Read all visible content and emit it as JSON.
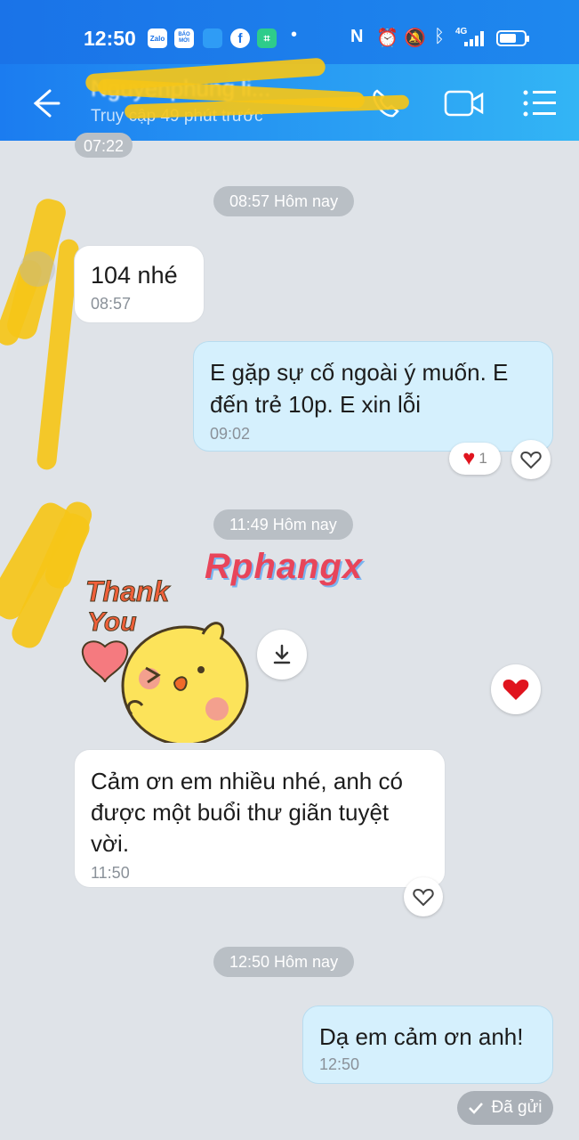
{
  "status_bar": {
    "time": "12:50",
    "apps": [
      "Zalo",
      "BÁO MỚI"
    ],
    "network": "4G",
    "battery_level": 0.7
  },
  "header": {
    "contact_name": "Nguyenphung li...",
    "last_seen": "Truy cập 49 phút trước",
    "icons": [
      "back-arrow-icon",
      "phone-icon",
      "video-call-icon",
      "menu-list-icon"
    ]
  },
  "chat": {
    "clipped_time": "07:22",
    "sections": [
      {
        "separator": "08:57 Hôm nay",
        "messages": [
          {
            "side": "in",
            "text": "104 nhé",
            "time": "08:57"
          },
          {
            "side": "out",
            "text": "E gặp sự cố ngoài ý muốn. E đến trẻ 10p. E xin lỗi",
            "time": "09:02",
            "reaction_count": "1"
          }
        ]
      },
      {
        "separator": "11:49 Hôm nay",
        "sticker": {
          "line1": "Thank",
          "line2": "You"
        },
        "messages": [
          {
            "side": "in",
            "text": "Cảm ơn em nhiều nhé, anh có được một buổi thư giãn tuyệt vời.",
            "time": "11:50"
          }
        ]
      },
      {
        "separator": "12:50 Hôm nay",
        "messages": [
          {
            "side": "out",
            "text": "Dạ em cảm ơn anh!",
            "time": "12:50",
            "status": "Đã gửi"
          }
        ]
      }
    ]
  },
  "watermark": "Rphangx",
  "colors": {
    "header_start": "#1b7cf0",
    "header_end": "#33b5f5",
    "outgoing_bubble": "#d5f0fd",
    "incoming_bubble": "#ffffff",
    "chat_background": "#dfe3e8",
    "scribble": "#f5c518"
  }
}
